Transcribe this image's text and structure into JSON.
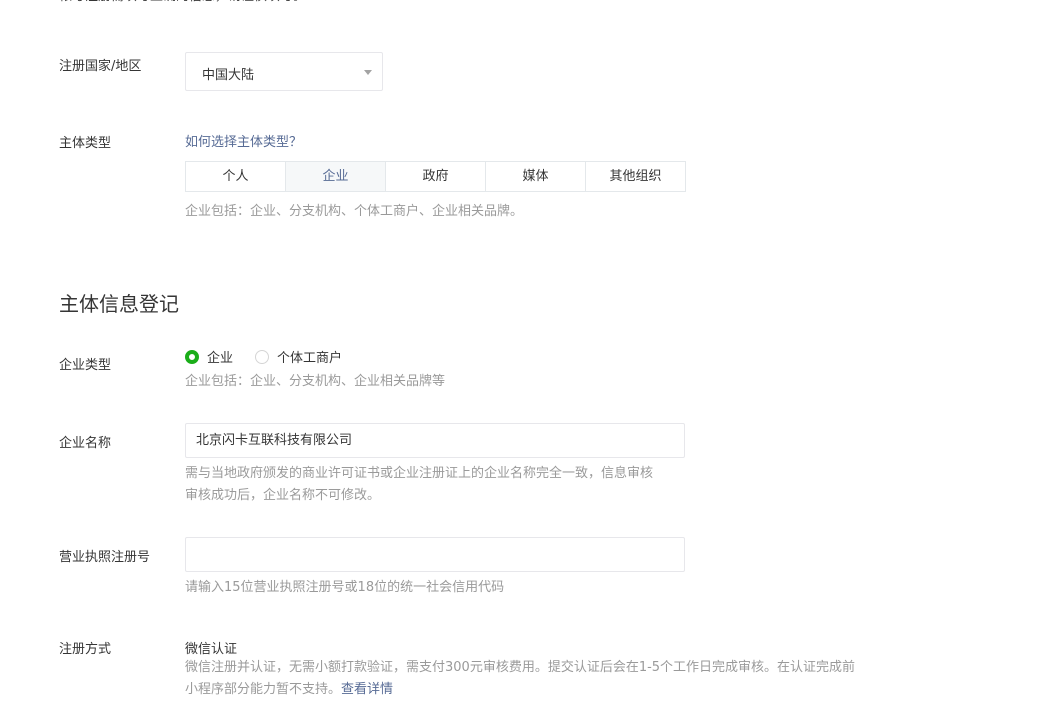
{
  "top_cut_text": "帐号注册需填写正确的信息，请谨慎填写。",
  "country": {
    "label": "注册国家/地区",
    "value": "中国大陆"
  },
  "entity_type": {
    "label": "主体类型",
    "help_link": "如何选择主体类型？",
    "tabs": [
      {
        "label": "个人",
        "active": false
      },
      {
        "label": "企业",
        "active": true
      },
      {
        "label": "政府",
        "active": false
      },
      {
        "label": "媒体",
        "active": false
      },
      {
        "label": "其他组织",
        "active": false
      }
    ],
    "tip": "企业包括：企业、分支机构、个体工商户、企业相关品牌。"
  },
  "section_title": "主体信息登记",
  "company_type": {
    "label": "企业类型",
    "options": [
      {
        "label": "企业",
        "checked": true
      },
      {
        "label": "个体工商户",
        "checked": false
      }
    ],
    "tip": "企业包括：企业、分支机构、企业相关品牌等"
  },
  "company_name": {
    "label": "企业名称",
    "value": "北京闪卡互联科技有限公司",
    "tip_line1": "需与当地政府颁发的商业许可证书或企业注册证上的企业名称完全一致，信息审核",
    "tip_line2": "审核成功后，企业名称不可修改。"
  },
  "license_number": {
    "label": "营业执照注册号",
    "value": "",
    "tip": "请输入15位营业执照注册号或18位的统一社会信用代码"
  },
  "register_method": {
    "label": "注册方式",
    "value": "微信认证",
    "tip_line1": "微信注册并认证，无需小额打款验证，需支付300元审核费用。提交认证后会在1-5个工作日完成审核。在认证完成前",
    "tip_line2": "小程序部分能力暂不支持。",
    "detail_link": "查看详情"
  },
  "colors": {
    "accent_green": "#1aad19",
    "link_blue": "#576b95",
    "tip_gray": "#9a9a9a"
  }
}
